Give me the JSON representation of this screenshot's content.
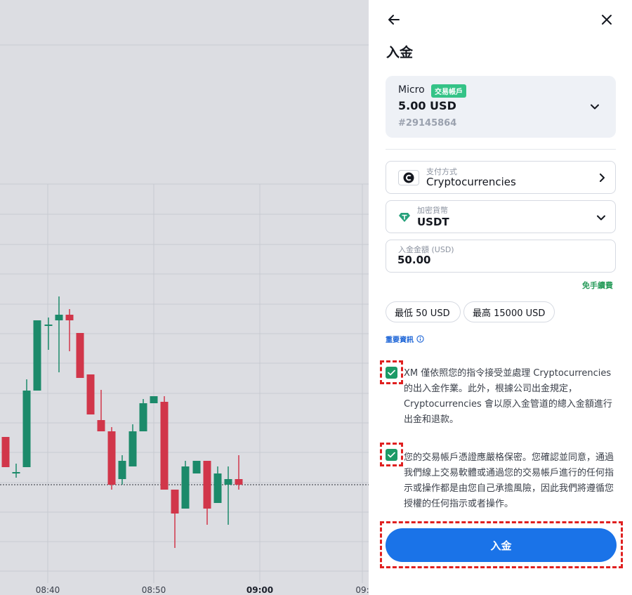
{
  "chart": {
    "time_labels": [
      "08:40",
      "08:50",
      "09:00",
      "09:"
    ],
    "colors": {
      "up": "#1c8a6a",
      "down": "#d1364a",
      "grid": "#c8cad1",
      "background": "#dcdde2"
    }
  },
  "panel": {
    "title": "入金",
    "back_icon": "arrow-left-icon",
    "close_icon": "close-icon",
    "account": {
      "name": "Micro",
      "badge": "交易帳戶",
      "balance": "5.00 USD",
      "number": "#29145864"
    },
    "payment_method": {
      "label": "支付方式",
      "value": "Cryptocurrencies"
    },
    "crypto": {
      "label": "加密貨幣",
      "value": "USDT"
    },
    "amount": {
      "label": "入金金額 (USD)",
      "value": "50.00"
    },
    "fee_note": "免手續費",
    "chips": {
      "min": "最低 50 USD",
      "max": "最高 15000 USD"
    },
    "info_link": "重要資訊",
    "consents": [
      {
        "checked": true,
        "text": "XM 僅依照您的指令接受並處理 Cryptocurrencies 的出入金作業。此外，根據公司出金規定，Cryptocurrencies 會以原入金管道的總入金額進行出金和退款。"
      },
      {
        "checked": true,
        "text": "您的交易帳戶憑證應嚴格保密。您確認並同意，通過我們線上交易軟體或通過您的交易帳戶進行的任何指示或操作都是由您自己承擔風險，因此我們將遵循您授權的任何指示或者操作。"
      }
    ],
    "submit_label": "入金",
    "colors": {
      "accent": "#1a73e8",
      "badge": "#34c387",
      "check": "#1c9a66",
      "fee": "#2a9d5c",
      "highlight": "#e02020"
    }
  }
}
